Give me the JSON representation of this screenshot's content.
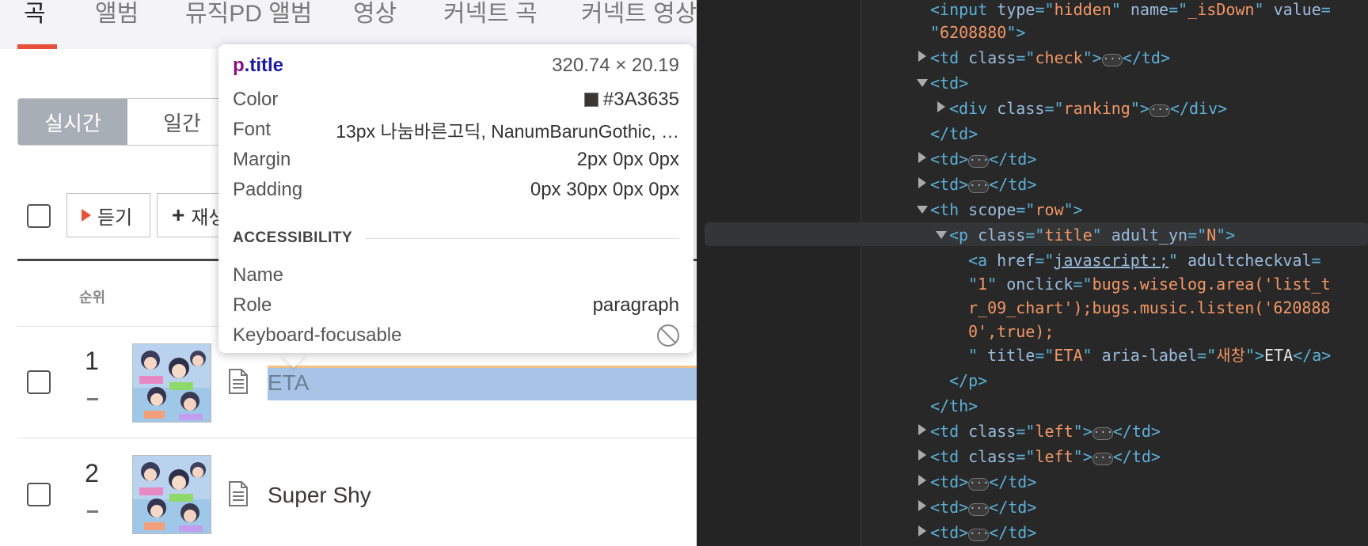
{
  "tabs": [
    {
      "label": "곡",
      "active": true
    },
    {
      "label": "앨범",
      "active": false
    },
    {
      "label": "뮤직PD 앨범",
      "active": false
    },
    {
      "label": "영상",
      "active": false
    },
    {
      "label": "커넥트 곡",
      "active": false
    },
    {
      "label": "커넥트 영상",
      "active": false
    }
  ],
  "period": [
    "실시간",
    "일간"
  ],
  "toolbar": {
    "listen_label": "듣기",
    "add_label": "재생"
  },
  "table": {
    "rank_header": "순위"
  },
  "rows": [
    {
      "rank": "1",
      "title": "ETA"
    },
    {
      "rank": "2",
      "title": "Super Shy"
    }
  ],
  "tooltip": {
    "selector_tag": "p",
    "selector_class": ".title",
    "size": "320.74 × 20.19",
    "props": [
      {
        "key": "Color",
        "value": "#3A3635"
      },
      {
        "key": "Font",
        "value": "13px 나눔바른고딕, NanumBarunGothic, …"
      },
      {
        "key": "Margin",
        "value": "2px 0px 0px"
      },
      {
        "key": "Padding",
        "value": "0px 30px 0px 0px"
      }
    ],
    "section": "ACCESSIBILITY",
    "a11y": [
      {
        "key": "Name",
        "value": ""
      },
      {
        "key": "Role",
        "value": "paragraph"
      },
      {
        "key": "Keyboard-focusable",
        "value": ""
      }
    ]
  },
  "colors": {
    "accent": "#e8503a",
    "text": "#3A3635",
    "highlight": "#a7c4e6",
    "devtools_bg": "#282828"
  },
  "devtools": {
    "lines": [
      "<input type=\"hidden\" name=\"_isDown\" value=",
      "\"6208880\">",
      "<td class=\"check\">…</td>",
      "<td>",
      "<div class=\"ranking\">…</div>",
      "</td>",
      "<td>…</td>",
      "<td>…</td>",
      "<th scope=\"row\">",
      "<p class=\"title\" adult_yn=\"N\">",
      "<a href=\"javascript:;\" adultcheckval=",
      "\"1\" onclick=\"bugs.wiselog.area('list_t",
      "r_09_chart');bugs.music.listen('620888",
      "0',true);",
      "\" title=\"ETA\" aria-label=\"새창\">ETA</a>",
      "</p>",
      "</th>",
      "<td class=\"left\">…</td>",
      "<td class=\"left\">…</td>",
      "<td>…</td>",
      "<td>…</td>",
      "<td>…</td>"
    ]
  }
}
